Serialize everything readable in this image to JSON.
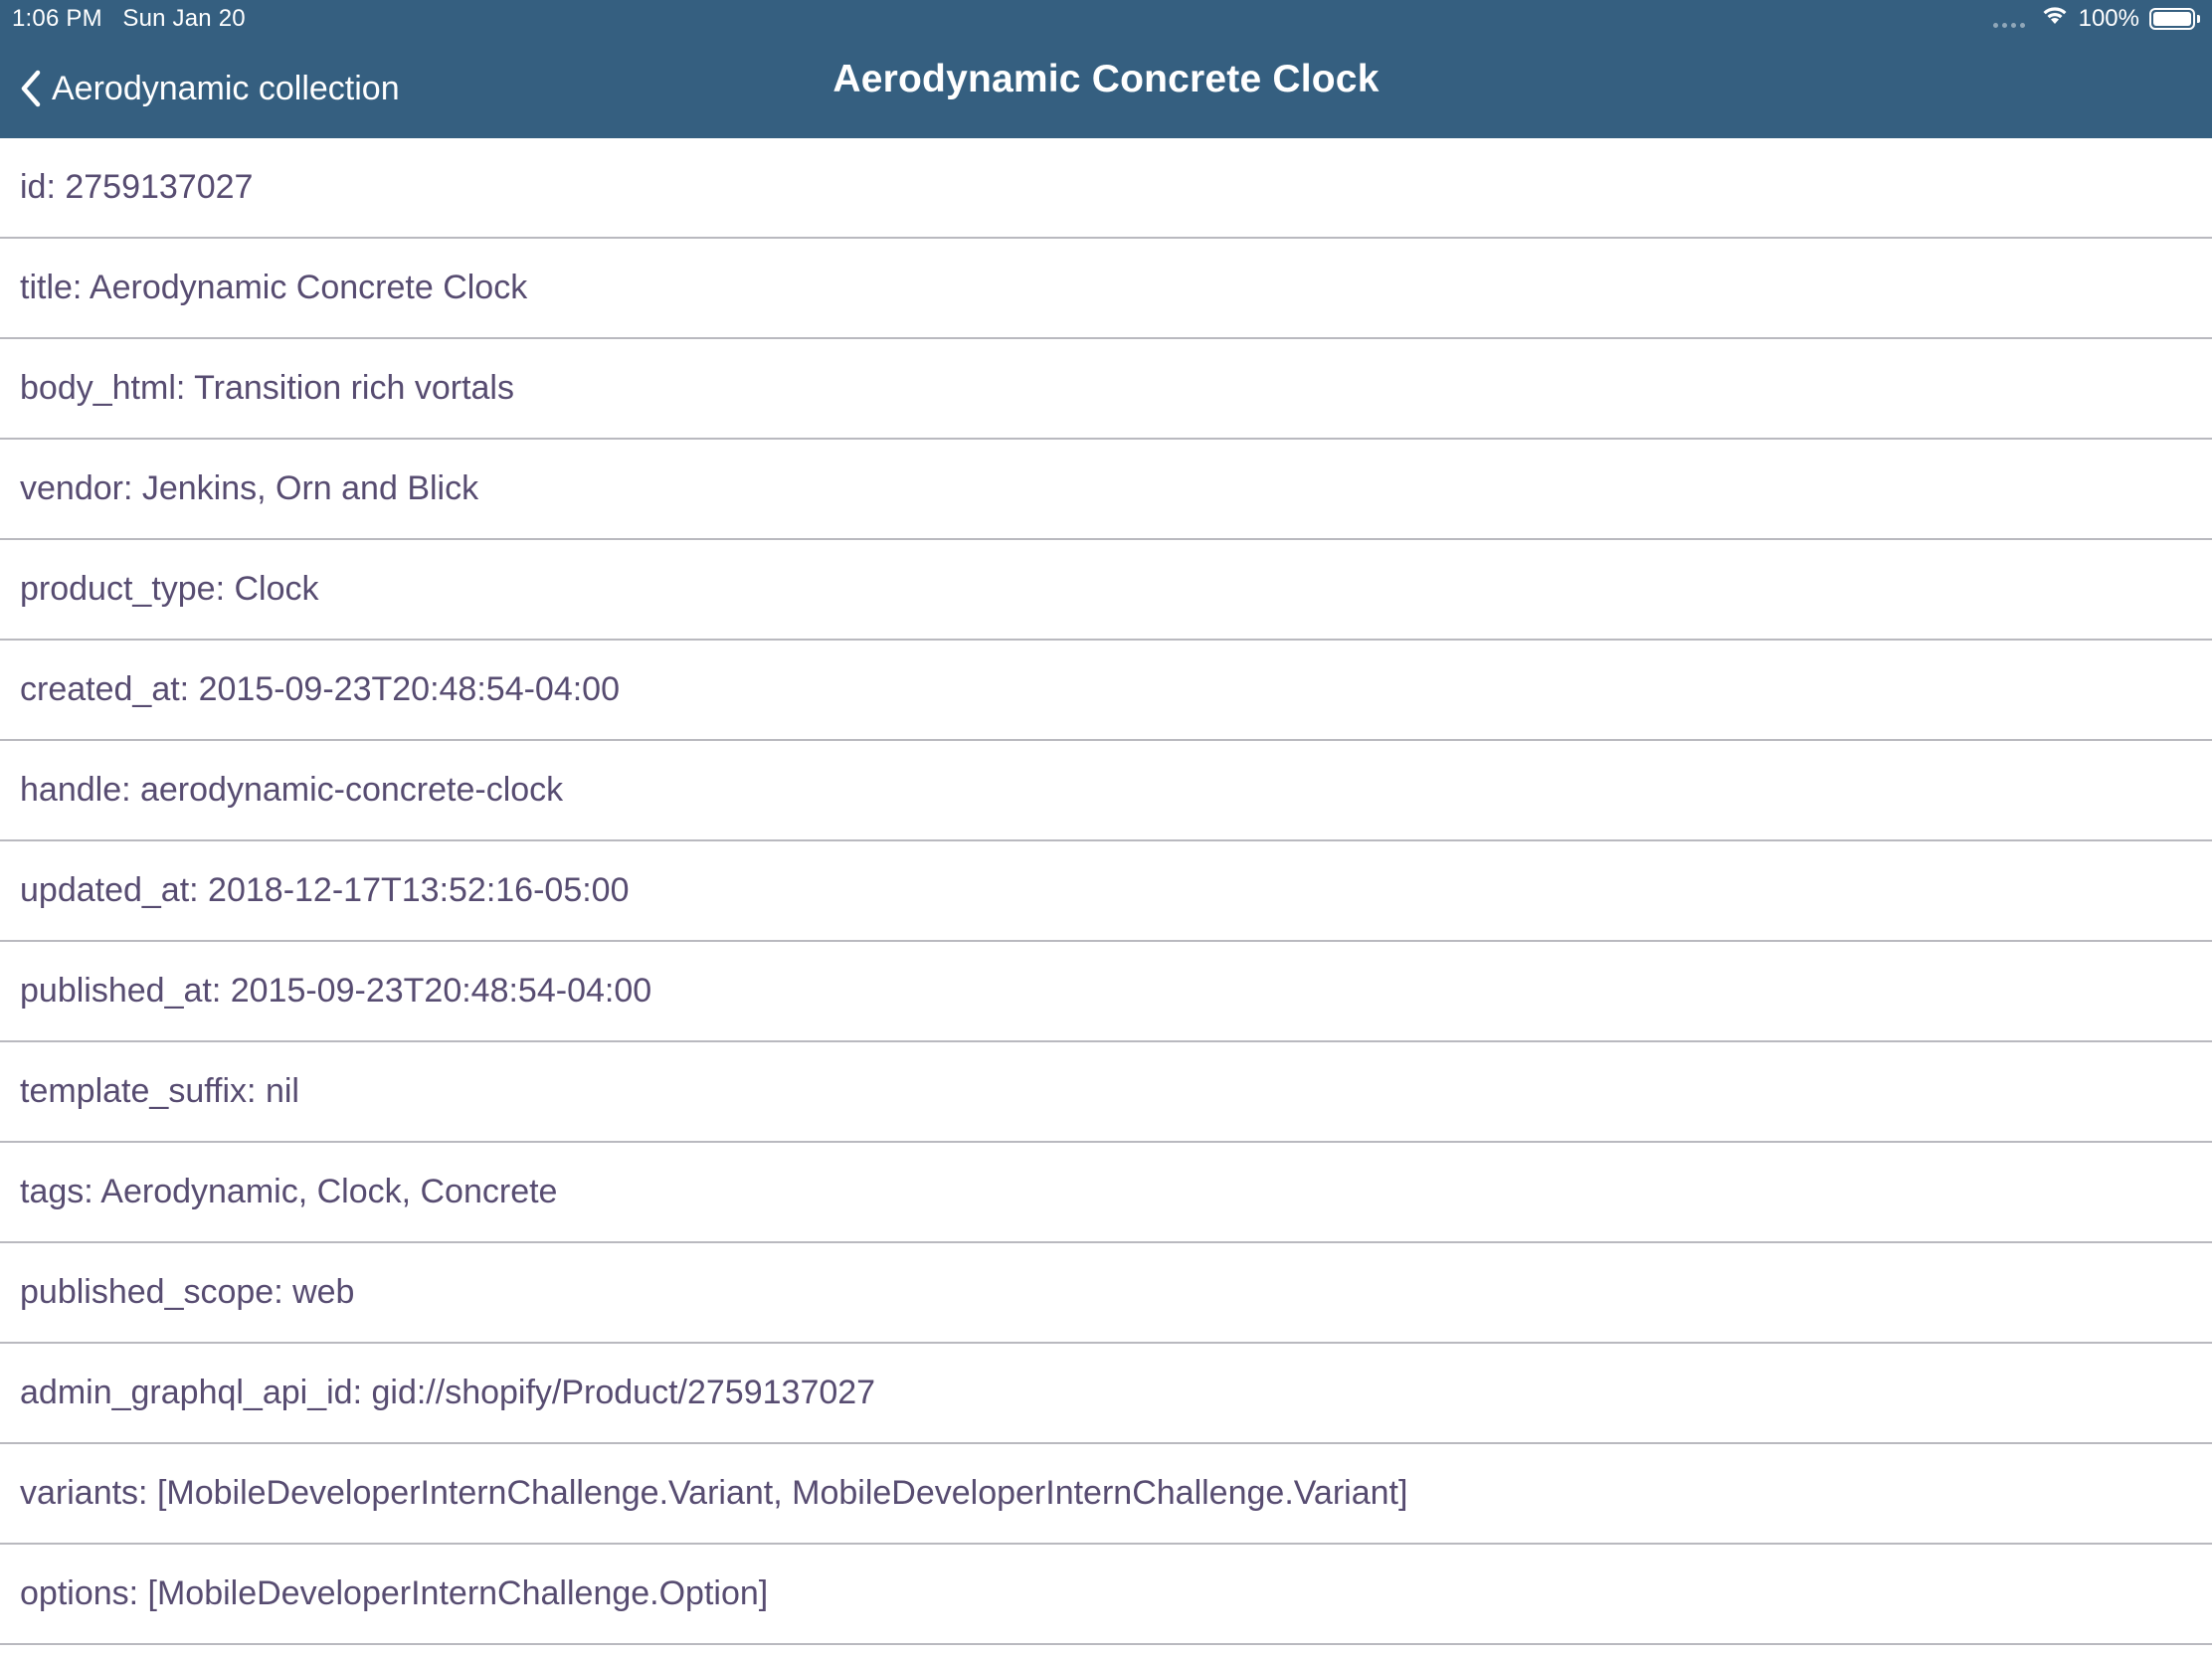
{
  "status_bar": {
    "time_date": "1:06 PM   Sun Jan 20",
    "battery": "100%",
    "battery_level": 1.0,
    "icons": [
      "cellular-dots-icon",
      "wifi-icon",
      "battery-icon"
    ]
  },
  "nav": {
    "back_label": "Aerodynamic collection",
    "title": "Aerodynamic Concrete Clock"
  },
  "colors": {
    "header_bg": "#355f80",
    "text": "#574c71",
    "separator": "#b9b9bf"
  },
  "rows": [
    "id: 2759137027",
    "title: Aerodynamic Concrete Clock",
    "body_html: Transition rich vortals",
    "vendor: Jenkins, Orn and Blick",
    "product_type: Clock",
    "created_at: 2015-09-23T20:48:54-04:00",
    "handle: aerodynamic-concrete-clock",
    "updated_at: 2018-12-17T13:52:16-05:00",
    "published_at: 2015-09-23T20:48:54-04:00",
    "template_suffix: nil",
    "tags: Aerodynamic, Clock, Concrete",
    "published_scope: web",
    "admin_graphql_api_id: gid://shopify/Product/2759137027",
    "variants: [MobileDeveloperInternChallenge.Variant, MobileDeveloperInternChallenge.Variant]",
    "options: [MobileDeveloperInternChallenge.Option]"
  ]
}
